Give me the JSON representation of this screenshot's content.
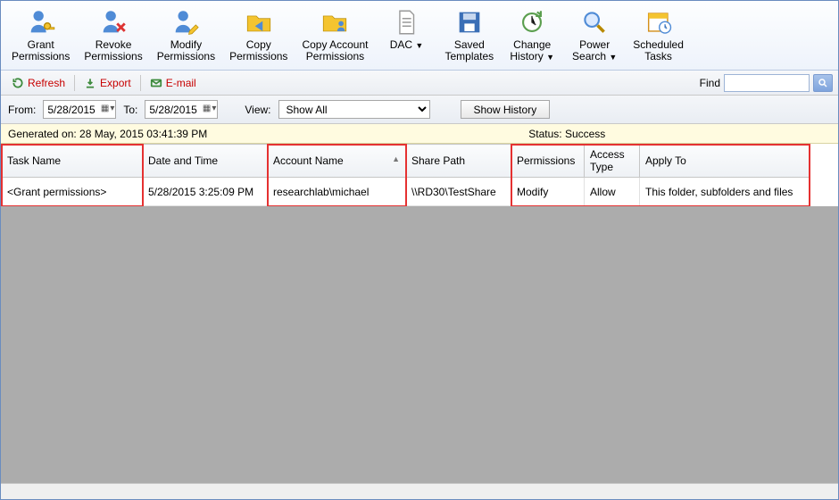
{
  "ribbon": [
    {
      "id": "grant",
      "label": "Grant\nPermissions",
      "icon": "person-key-icon"
    },
    {
      "id": "revoke",
      "label": "Revoke\nPermissions",
      "icon": "person-x-icon"
    },
    {
      "id": "modify",
      "label": "Modify\nPermissions",
      "icon": "person-pencil-icon"
    },
    {
      "id": "copy",
      "label": "Copy\nPermissions",
      "icon": "folder-share-icon"
    },
    {
      "id": "copyacct",
      "label": "Copy Account\nPermissions",
      "icon": "folder-user-icon"
    },
    {
      "id": "dac",
      "label": "DAC",
      "icon": "document-icon",
      "dropdown": true
    },
    {
      "id": "saved",
      "label": "Saved\nTemplates",
      "icon": "floppy-icon"
    },
    {
      "id": "changehist",
      "label": "Change\nHistory",
      "icon": "clock-refresh-icon",
      "dropdown": true
    },
    {
      "id": "powersearch",
      "label": "Power\nSearch",
      "icon": "magnifier-icon",
      "dropdown": true
    },
    {
      "id": "schedtasks",
      "label": "Scheduled\nTasks",
      "icon": "calendar-clock-icon"
    }
  ],
  "secondary": {
    "refresh": "Refresh",
    "export": "Export",
    "email": "E-mail",
    "find_label": "Find"
  },
  "filter": {
    "from_label": "From:",
    "to_label": "To:",
    "from_value": "5/28/2015",
    "to_value": "5/28/2015",
    "view_label": "View:",
    "view_value": "Show All",
    "show_history": "Show History"
  },
  "status": {
    "generated_label": "Generated on: 28 May, 2015 03:41:39 PM",
    "status_text": "Status: Success"
  },
  "columns": {
    "task": "Task Name",
    "date": "Date and Time",
    "acct": "Account Name",
    "share": "Share Path",
    "perm": "Permissions",
    "access": "Access\nType",
    "apply": "Apply To"
  },
  "rows": [
    {
      "task": "<Grant permissions>",
      "date": "5/28/2015 3:25:09 PM",
      "acct": "researchlab\\michael",
      "share": "\\\\RD30\\TestShare",
      "perm": "Modify",
      "access": "Allow",
      "apply": "This folder, subfolders and files"
    }
  ],
  "highlight_cols": [
    "task",
    "acct",
    "perm",
    "access",
    "apply"
  ]
}
